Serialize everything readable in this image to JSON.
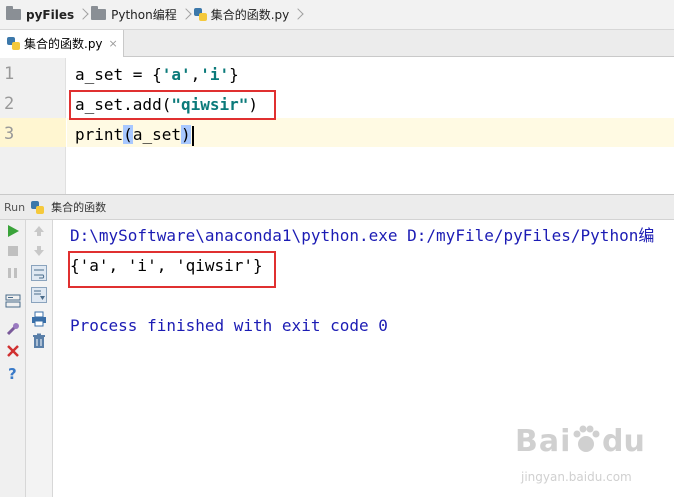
{
  "breadcrumb": {
    "items": [
      {
        "label": "pyFiles",
        "icon": "folder-icon"
      },
      {
        "label": "Python编程",
        "icon": "folder-icon"
      },
      {
        "label": "集合的函数.py",
        "icon": "python-file-icon"
      }
    ]
  },
  "editor_tab": {
    "label": "集合的函数.py",
    "close_glyph": "×"
  },
  "editor": {
    "line_numbers": [
      "1",
      "2",
      "3"
    ],
    "lines": [
      {
        "p1": "a_set = {",
        "s1": "'a'",
        "p2": ",",
        "s2": "'i'",
        "p3": "}"
      },
      {
        "p1": "a_set.add(",
        "s1": "\"qiwsir\"",
        "p2": ")"
      },
      {
        "p1": "print",
        "b1": "(",
        "p2": "a_set",
        "b2": ")"
      }
    ]
  },
  "run_panel": {
    "title": "Run",
    "config": "集合的函数",
    "output": [
      "D:\\mySoftware\\anaconda1\\python.exe D:/myFile/pyFiles/Python编",
      "{'a', 'i', 'qiwsir'}",
      "",
      "Process finished with exit code 0"
    ]
  },
  "watermark": {
    "brand": "Bai",
    "brand2": "du",
    "site": "jingyan.baidu.com"
  },
  "colors": {
    "keyword_string": "#0b7a7a",
    "console_blue": "#1c1cb4",
    "annotation_red": "#e03030",
    "line_highlight": "#fffae3",
    "brace_match": "#a8c8ff"
  }
}
